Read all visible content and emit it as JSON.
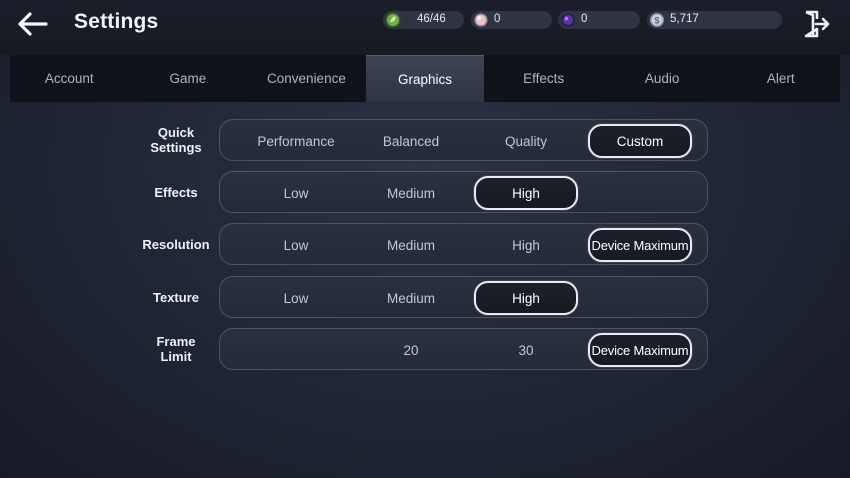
{
  "header": {
    "title": "Settings",
    "back_icon": "arrow-left-icon",
    "exit_icon": "exit-door-icon"
  },
  "currencies": [
    {
      "name": "stamina",
      "icon": "leaf-badge-icon",
      "value": "46/46",
      "color": "#6fb04a"
    },
    {
      "name": "pearl",
      "icon": "pink-orb-icon",
      "value": "0",
      "color": "#d8b0b8"
    },
    {
      "name": "gem",
      "icon": "purple-orb-icon",
      "value": "0",
      "color": "#4a2b8a"
    },
    {
      "name": "silver",
      "icon": "silver-coin-icon",
      "value": "5,717",
      "color": "#b9c6d8"
    }
  ],
  "tabs": [
    {
      "label": "Account",
      "active": false
    },
    {
      "label": "Game",
      "active": false
    },
    {
      "label": "Convenience",
      "active": false
    },
    {
      "label": "Graphics",
      "active": true
    },
    {
      "label": "Effects",
      "active": false
    },
    {
      "label": "Audio",
      "active": false
    },
    {
      "label": "Alert",
      "active": false
    }
  ],
  "settings": [
    {
      "label": "Quick\nSettings",
      "options": [
        "Performance",
        "Balanced",
        "Quality",
        "Custom"
      ],
      "selected": "Custom"
    },
    {
      "label": "Effects",
      "options": [
        "Low",
        "Medium",
        "High"
      ],
      "selected": "High"
    },
    {
      "label": "Resolution",
      "options": [
        "Low",
        "Medium",
        "High",
        "Device Maximum"
      ],
      "selected": "Device Maximum"
    },
    {
      "label": "Texture",
      "options": [
        "Low",
        "Medium",
        "High"
      ],
      "selected": "High"
    },
    {
      "label": "Frame\nLimit",
      "options": [
        "",
        "20",
        "30",
        "Device Maximum"
      ],
      "selected": "Device Maximum"
    }
  ],
  "colors": {
    "background": "#232938",
    "tab_bar": "#0f1219",
    "active_tab": "#3d4557",
    "selected_border": "#e8ebf0"
  }
}
